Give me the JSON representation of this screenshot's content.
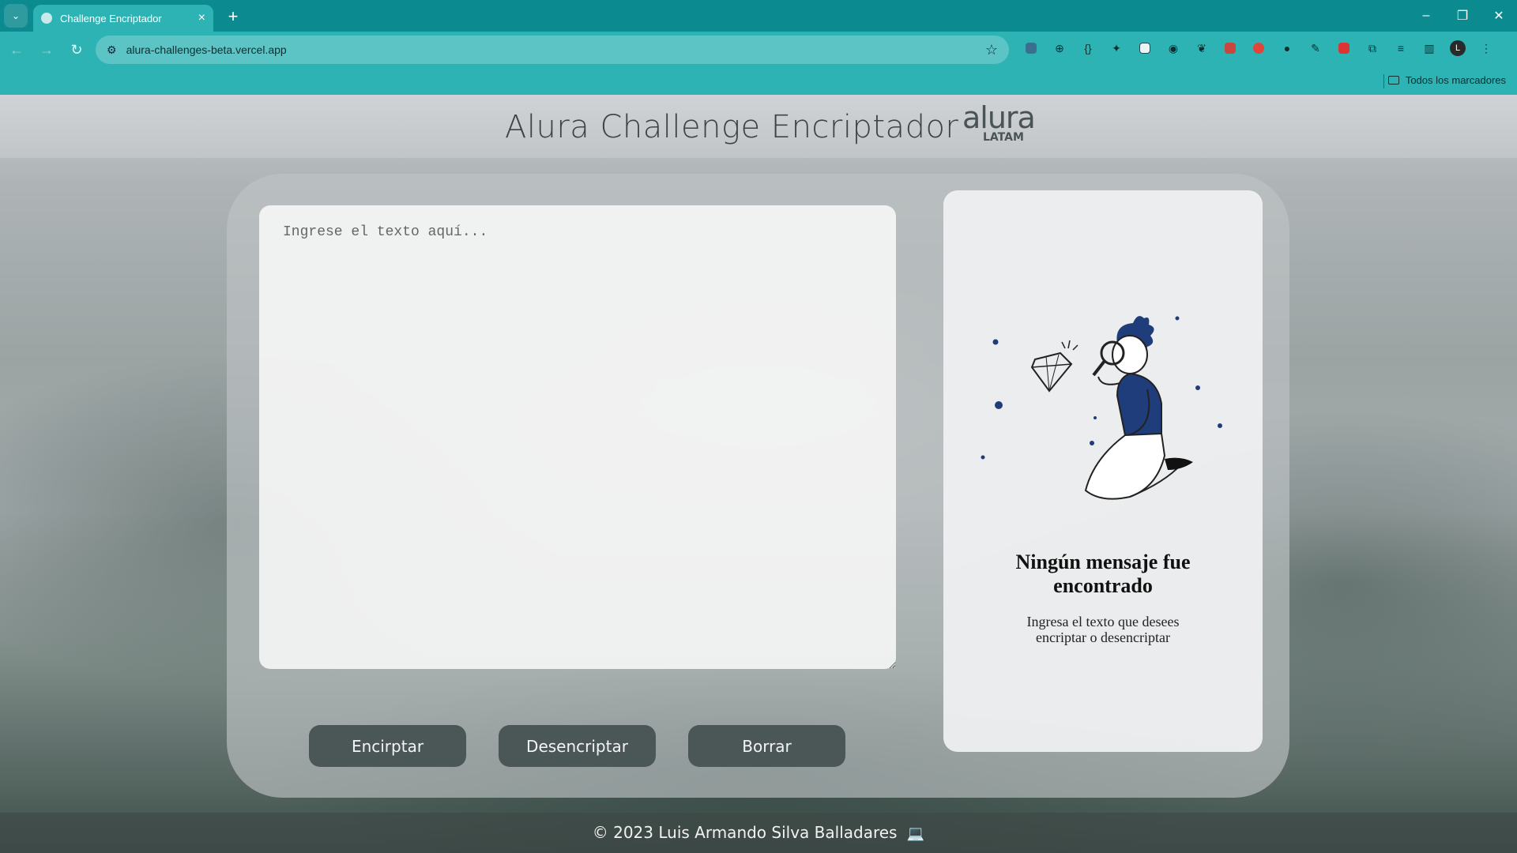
{
  "browser": {
    "tab_title": "Challenge Encriptador",
    "url": "alura-challenges-beta.vercel.app",
    "bookmarks_label": "Todos los marcadores",
    "profile_initial": "L"
  },
  "header": {
    "title": "Alura Challenge Encriptador",
    "logo_word": "alura",
    "logo_sub": "LATAM"
  },
  "input": {
    "placeholder": "Ingrese el texto aquí..."
  },
  "buttons": {
    "encrypt": "Encirptar",
    "decrypt": "Desencriptar",
    "clear": "Borrar"
  },
  "result": {
    "title": "Ningún mensaje fue encontrado",
    "subtitle": "Ingresa el texto que desees encriptar o desencriptar"
  },
  "footer": {
    "text": "© 2023 Luis Armando Silva Balladares"
  },
  "colors": {
    "chrome_dark": "#0b8a8f",
    "chrome_light": "#2eb3b5",
    "button_bg": "#4b5656",
    "illustration_blue": "#1f3d7a"
  }
}
